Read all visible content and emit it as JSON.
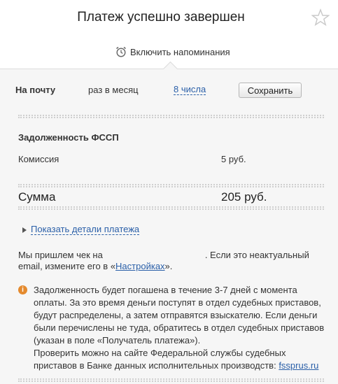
{
  "header": {
    "title": "Платеж успешно завершен",
    "reminder_label": "Включить напоминания"
  },
  "reminder_row": {
    "channel": "На почту",
    "frequency": "раз в месяц",
    "day": "8 числа",
    "save_label": "Сохранить"
  },
  "payment": {
    "service": "Задолженность ФССП",
    "fee_label": "Комиссия",
    "fee_value": "5 руб.",
    "total_label": "Сумма",
    "total_value": "205 руб.",
    "details_link": "Показать детали платежа"
  },
  "receipt": {
    "prefix": "Мы пришлем чек на",
    "middle": ". Если это неактуальный email, измените его в «",
    "settings_link": "Настройках",
    "suffix": "»."
  },
  "notice": {
    "text": "Задолженность будет погашена в течение 3-7 дней с момента оплаты. За это время деньги поступят в отдел судебных приставов, будут распределены, а затем отправятся взыскателю. Если деньги были перечислены не туда, обратитесь в отдел судебных приставов (указан в поле «Получатель платежа»).",
    "check_text": "Проверить можно на сайте Федеральной службы судебных приставов в Банке данных исполнительных производств: ",
    "link": "fssprus.ru"
  },
  "colors": {
    "link": "#2a5fa8",
    "panel_bg": "#f6f6f6",
    "info_icon": "#e48a2e"
  },
  "icons": [
    "star-icon",
    "alarm-clock-icon",
    "expand-triangle-icon",
    "info-icon"
  ]
}
